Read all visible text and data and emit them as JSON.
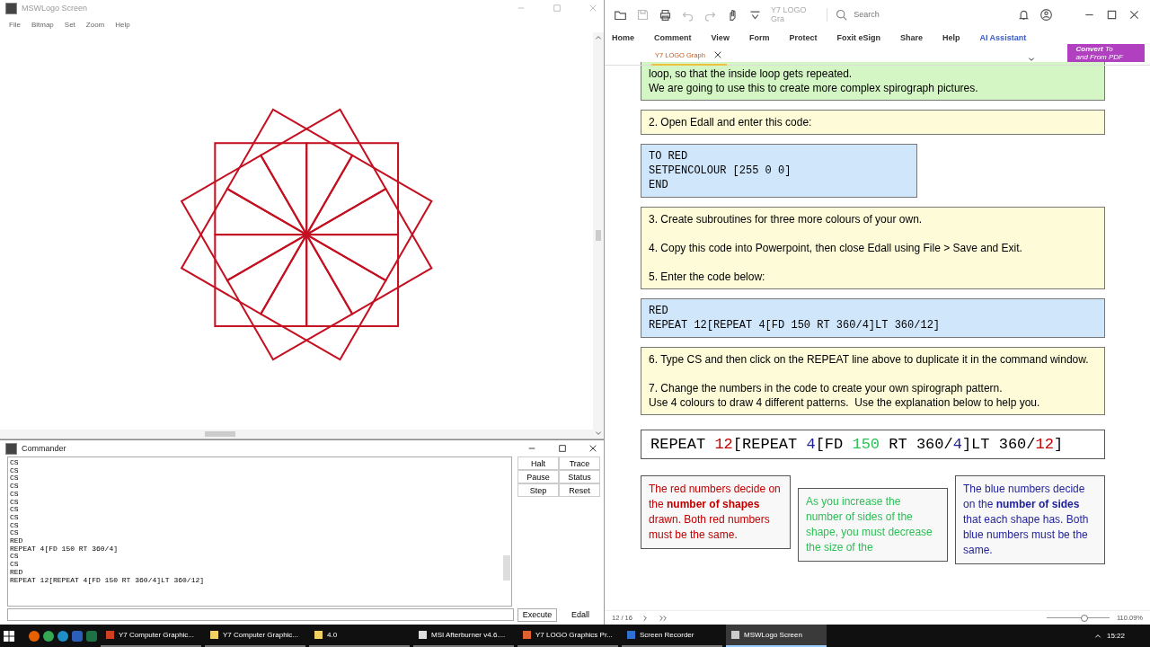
{
  "logo_window": {
    "title": "MSWLogo Screen",
    "menu": [
      "File",
      "Bitmap",
      "Set",
      "Zoom",
      "Help"
    ]
  },
  "commander": {
    "title": "Commander",
    "lines": [
      "CS",
      "CS",
      "CS",
      "CS",
      "CS",
      "CS",
      "CS",
      "CS",
      "CS",
      "CS",
      "RED",
      "REPEAT 4[FD 150 RT 360/4]",
      "CS",
      "CS",
      "RED",
      "REPEAT 12[REPEAT 4[FD 150 RT 360/4]LT 360/12]"
    ],
    "buttons": [
      "Halt",
      "Trace",
      "Pause",
      "Status",
      "Step",
      "Reset"
    ],
    "execute": "Execute",
    "edall": "Edall"
  },
  "reader": {
    "doc_name": "Y7 LOGO Gra",
    "search": {
      "placeholder": "Search"
    },
    "ribbon": [
      {
        "label": "Home",
        "kind": "plain"
      },
      {
        "label": "Comment",
        "kind": "plain"
      },
      {
        "label": "View",
        "kind": "plain"
      },
      {
        "label": "Form",
        "kind": "plain"
      },
      {
        "label": "Protect",
        "kind": "plain"
      },
      {
        "label": "Foxit eSign",
        "kind": "plain"
      },
      {
        "label": "Share",
        "kind": "plain"
      },
      {
        "label": "Help",
        "kind": "plain"
      },
      {
        "label": "AI Assistant",
        "kind": "ai"
      }
    ],
    "tab": "Y7 LOGO Graph",
    "convert": [
      "**Convert** To",
      "and From PDF"
    ],
    "blocks": [
      {
        "kind": "note",
        "paragraphs": [
          "loop, so that the inside loop gets repeated.\nWe are going to use this to create more complex spirograph pictures."
        ]
      },
      {
        "kind": "step",
        "paragraphs": [
          "2. Open Edall and enter this code:"
        ]
      },
      {
        "kind": "code",
        "wide": false,
        "paragraphs": [
          "TO RED\nSETPENCOLOUR [255 0 0]\nEND"
        ]
      },
      {
        "kind": "step",
        "paragraphs": [
          "3. Create subroutines for three more colours of your own.",
          "4. Copy this code into Powerpoint, then close Edall using File > Save and Exit.",
          "5. Enter the code below:"
        ]
      },
      {
        "kind": "code",
        "wide": true,
        "paragraphs": [
          "RED\nREPEAT 12[REPEAT 4[FD 150 RT 360/4]LT 360/12]"
        ]
      },
      {
        "kind": "step",
        "paragraphs": [
          "6. Type CS and then click on the REPEAT line above to duplicate it in the command window.",
          "7. Change the numbers in the code to create your own spirograph pattern.\nUse 4 colours to draw 4 different patterns.  Use the explanation below to help you."
        ]
      }
    ],
    "formula": [
      {
        "text": "REPEAT "
      },
      {
        "text": "12",
        "color": "#c00000"
      },
      {
        "text": "[REPEAT "
      },
      {
        "text": "4",
        "color": "#1f1f9a"
      },
      {
        "text": "[FD "
      },
      {
        "text": "150",
        "color": "#2cbf55"
      },
      {
        "text": " RT 360/"
      },
      {
        "text": "4",
        "color": "#1f1f9a"
      },
      {
        "text": "]LT 360/"
      },
      {
        "text": "12",
        "color": "#c00000"
      },
      {
        "text": "]"
      }
    ],
    "explanations": [
      {
        "color": "#c00000",
        "text": "The red numbers decide on the **number of shapes** drawn.  Both red numbers must be the same."
      },
      {
        "color": "#2cbf55",
        "text": "As you increase the number of sides of the shape, you must decrease the size of the"
      },
      {
        "color": "#1f1f9a",
        "text": "The blue numbers decide on the **number of sides** that each shape has.  Both blue numbers must be the same."
      }
    ],
    "page": "12 / 16",
    "zoom": "110.09%",
    "zoom_slider": {
      "level": 0.6
    }
  },
  "taskbar": {
    "items": [
      {
        "label": "Y7 Computer Graphic...",
        "color": "#d04020",
        "selected": false
      },
      {
        "label": "Y7 Computer Graphic...",
        "color": "#f0d060",
        "selected": false
      },
      {
        "label": "4.0",
        "color": "#f0d060",
        "selected": false
      },
      {
        "label": "MSI Afterburner v4.6....",
        "color": "#dddddd",
        "selected": false
      },
      {
        "label": "Y7 LOGO Graphics Pr...",
        "color": "#e06030",
        "selected": false
      },
      {
        "label": "Screen Recorder",
        "color": "#3070d0",
        "selected": false
      },
      {
        "label": "MSWLogo Screen",
        "color": "#cccccc",
        "selected": true
      }
    ],
    "time": "15:22"
  }
}
